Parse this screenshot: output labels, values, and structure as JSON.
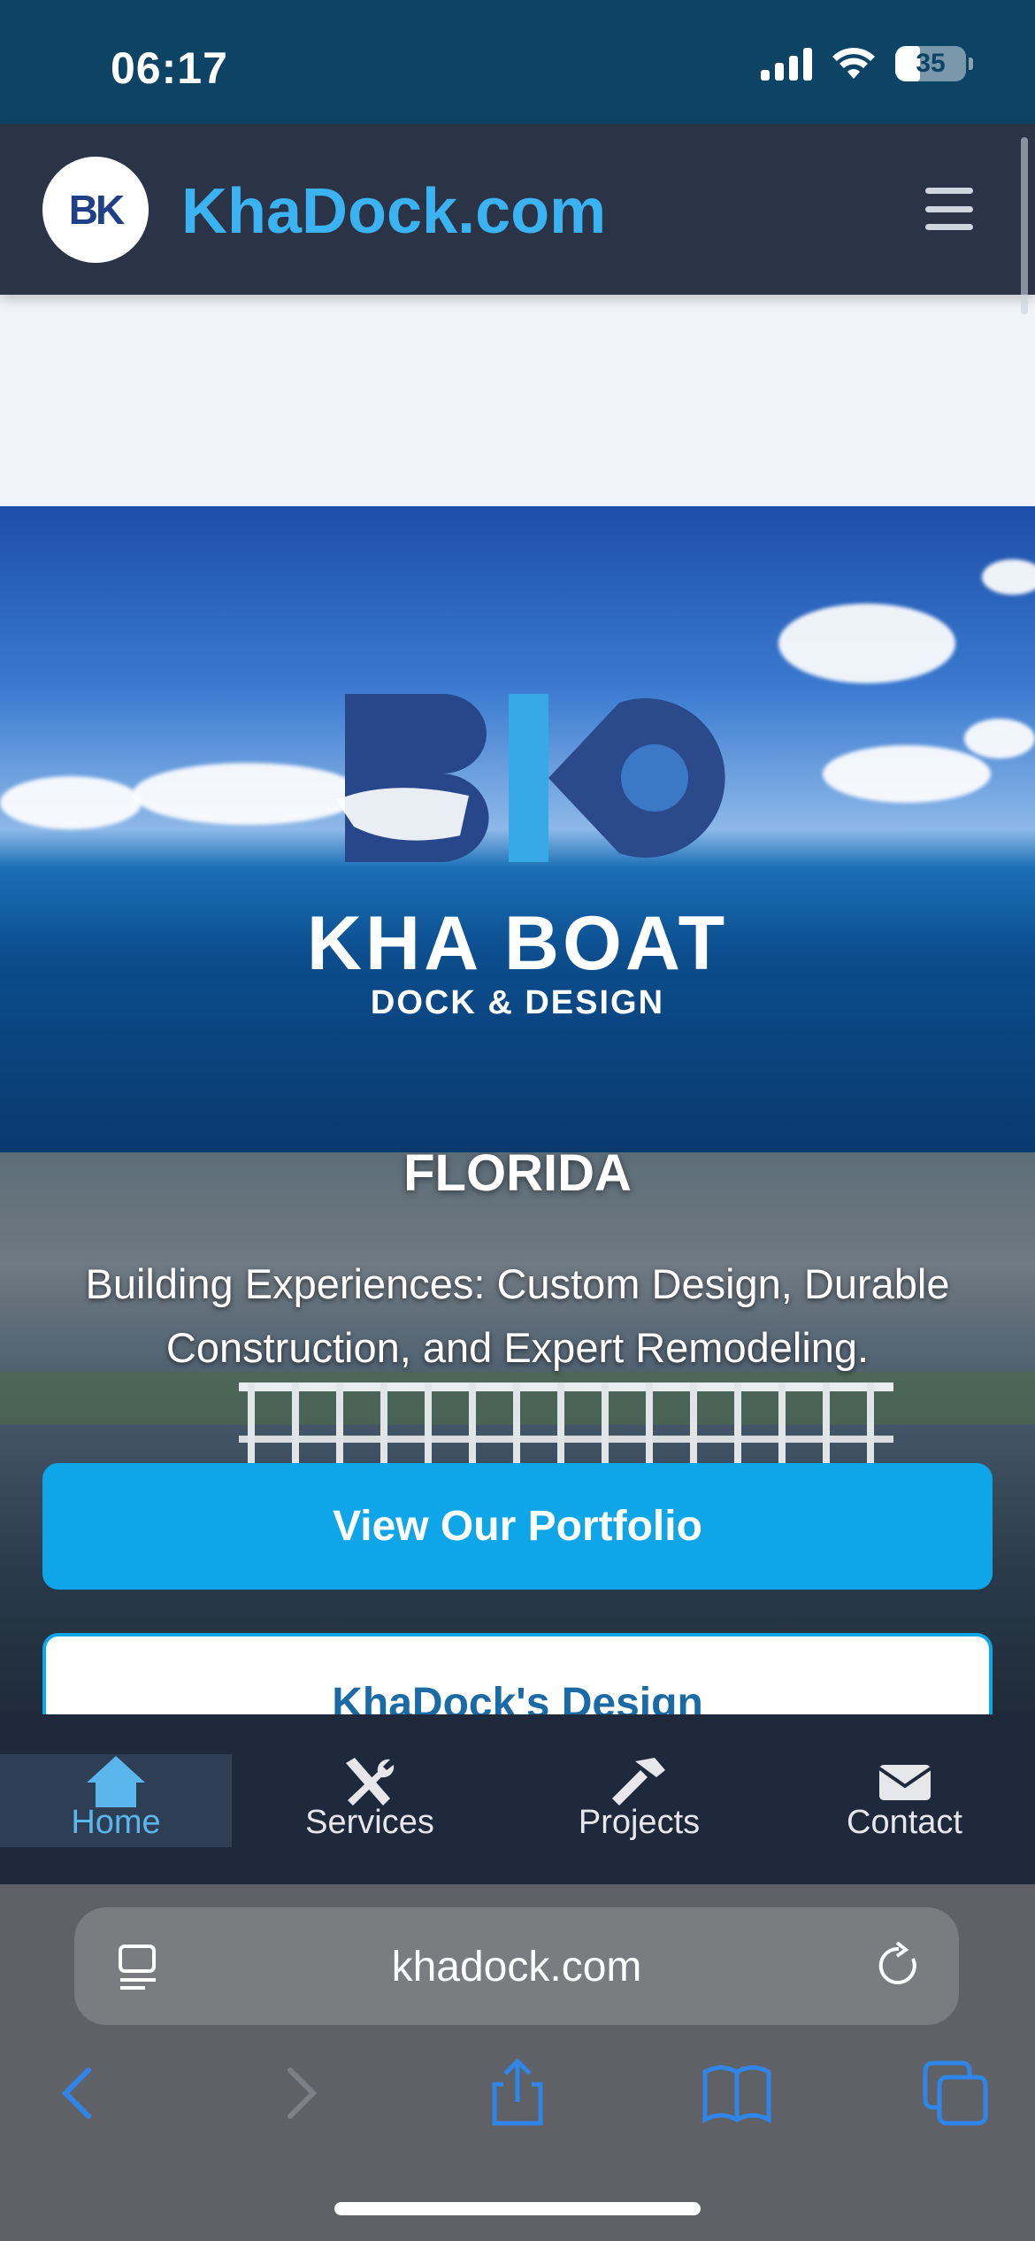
{
  "status_bar": {
    "time": "06:17",
    "battery": "35",
    "battery_level": 0.35
  },
  "header": {
    "logo_text": "BK",
    "site_name": "KhaDock.com"
  },
  "hero": {
    "logo_title": "KHA BOAT",
    "logo_subtitle": "DOCK & DESIGN",
    "region": "FLORIDA",
    "tagline": "Building Experiences: Custom Design, Durable Construction, and Expert Remodeling.",
    "primary_button": "View Our Portfolio",
    "secondary_button": "KhaDock's Design"
  },
  "bottom_nav": {
    "items": [
      {
        "label": "Home",
        "icon": "home-icon",
        "active": true
      },
      {
        "label": "Services",
        "icon": "tools-icon",
        "active": false
      },
      {
        "label": "Projects",
        "icon": "hammer-icon",
        "active": false
      },
      {
        "label": "Contact",
        "icon": "envelope-icon",
        "active": false
      }
    ]
  },
  "browser": {
    "url": "khadock.com"
  },
  "colors": {
    "header_bg": "#2a3446",
    "brand_blue": "#3bb3f2",
    "button_blue": "#0ea5e9",
    "nav_active": "#5ab6ec"
  }
}
